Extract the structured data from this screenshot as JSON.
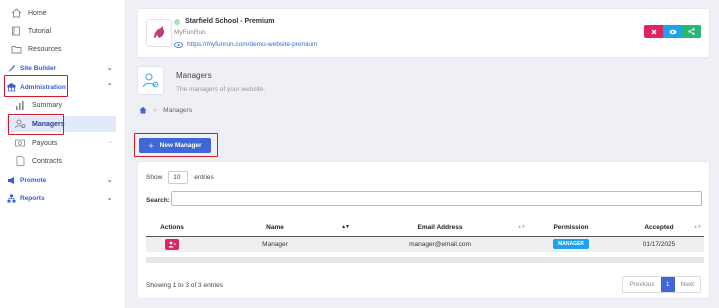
{
  "sidebar": {
    "home": "Home",
    "tutorial": "Tutorial",
    "resources": "Resources",
    "site_builder": "Site Builder",
    "administration": "Administration",
    "summary": "Summary",
    "managers": "Managers",
    "payouts": "Payouts",
    "contracts": "Contracts",
    "promote": "Promote",
    "reports": "Reports"
  },
  "header": {
    "school_name": "Starfield School - Premium",
    "brand": "MyFunRun",
    "url": "https://myfunrun.com/demo-website-premium"
  },
  "page": {
    "title": "Managers",
    "subtitle": "The managers of your website.",
    "breadcrumb": "Managers"
  },
  "actions": {
    "new_manager": "New Manager"
  },
  "table": {
    "show_label": "Show",
    "entries_value": "10",
    "entries_label": "entries",
    "search_label": "Search:",
    "columns": [
      "Actions",
      "Name",
      "Email Address",
      "Permission",
      "Accepted"
    ],
    "rows": [
      {
        "name": "Manager",
        "email": "manager@email.com",
        "permission": "MANAGER",
        "accepted": "01/17/2025"
      }
    ],
    "info": "Showing 1 to 3 of 3 entries",
    "pagination": {
      "previous": "Previous",
      "current": "1",
      "next": "Next"
    }
  },
  "colors": {
    "primary": "#3f67d6",
    "danger": "#e0245e",
    "info": "#1da1f2",
    "highlight": "#d11a2a"
  }
}
